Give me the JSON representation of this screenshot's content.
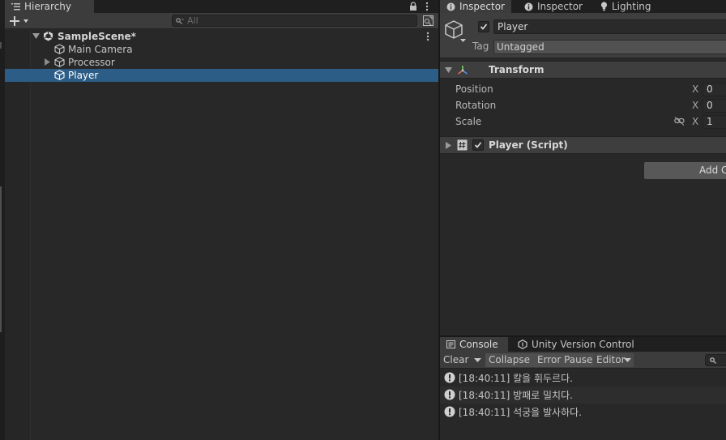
{
  "hierarchy": {
    "tab_title": "Hierarchy",
    "search_placeholder": "All",
    "scene_name": "SampleScene*",
    "items": [
      {
        "label": "Main Camera",
        "icon": "gameobject-cube-icon",
        "expandable": false,
        "selected": false
      },
      {
        "label": "Processor",
        "icon": "gameobject-cube-icon",
        "expandable": true,
        "selected": false
      },
      {
        "label": "Player",
        "icon": "gameobject-cube-icon",
        "expandable": false,
        "selected": true
      }
    ]
  },
  "inspector": {
    "tabs": [
      {
        "label": "Inspector",
        "icon": "info-icon",
        "active": true
      },
      {
        "label": "Inspector",
        "icon": "info-icon",
        "active": false
      },
      {
        "label": "Lighting",
        "icon": "lightbulb-icon",
        "active": false
      }
    ],
    "object_name": "Player",
    "object_active": true,
    "tag_label": "Tag",
    "tag_value": "Untagged",
    "transform": {
      "title": "Transform",
      "properties": [
        {
          "label": "Position",
          "axis": "X",
          "value": "0"
        },
        {
          "label": "Rotation",
          "axis": "X",
          "value": "0"
        },
        {
          "label": "Scale",
          "axis": "X",
          "value": "1"
        }
      ]
    },
    "script_component": {
      "title": "Player (Script)",
      "enabled": true
    },
    "add_component_label": "Add C"
  },
  "console": {
    "tabs": [
      {
        "label": "Console",
        "icon": "console-icon",
        "active": true
      },
      {
        "label": "Unity Version Control",
        "icon": "version-control-icon",
        "active": false
      }
    ],
    "toolbar": {
      "clear": "Clear",
      "collapse": "Collapse",
      "error_pause": "Error Pause",
      "editor": "Editor"
    },
    "logs": [
      {
        "time": "[18:40:11]",
        "message": "칼을 휘두르다.",
        "text": "[18:40:11] 칼을 휘두르다."
      },
      {
        "time": "[18:40:11]",
        "message": "방패로 밀치다.",
        "text": "[18:40:11] 방패로 밀치다."
      },
      {
        "time": "[18:40:11]",
        "message": "석궁을 발사하다.",
        "text": "[18:40:11] 석궁을 발사하다."
      }
    ]
  },
  "colors": {
    "selection": "#2c5d87",
    "panel": "#282828",
    "header": "#3e3e3e"
  }
}
